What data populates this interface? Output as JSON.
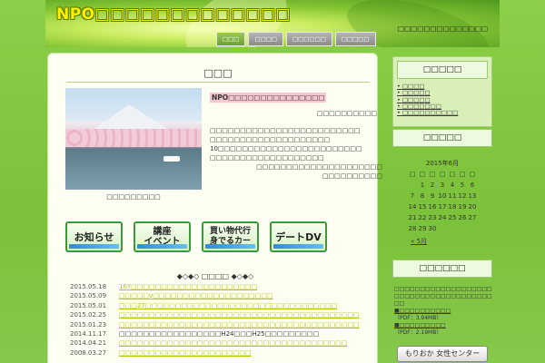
{
  "header": {
    "site_title": "NPO□□□□□□□□□□□□□",
    "tagline": "□□□□□□□□□□□□□□",
    "nav": [
      "□□□",
      "□□□□",
      "□□□□□□",
      "□□□□□"
    ]
  },
  "main": {
    "page_title": "□□□",
    "photo_caption": "□□□□□□□□□",
    "org_name": "NPO□□□□□□□□□□□□□□□",
    "subtitle": "□□□□□□□□□□",
    "description": [
      "□□□□□□□□□□□□□□□□□□□□□□□□□",
      "□□□□□□□□□□□□□□□□□□□□",
      "10□□□□□□□□□□□□□□□□□□□□□□□□",
      "□□□□□□□□□□□□□□□□□□□"
    ],
    "address": [
      "□□□□□□□□□□□□□□□□□□□□□",
      "□□□□□□□□□□"
    ],
    "buttons": [
      {
        "label": "お知らせ"
      },
      {
        "label": "講座\nイベント"
      },
      {
        "label": "買い物代行\n身でるカー"
      },
      {
        "label": "デートDV"
      }
    ],
    "news_title": "◆◇◆◇ □□□□ ◆◇◆◇",
    "news": [
      {
        "date": "2015.05.18",
        "text": "16Y□□□□□□□□□□□□□□□□□□□□□",
        "link": true
      },
      {
        "date": "2015.05.09",
        "text": "□□□□□v□□□□□□□□□□□□□□□□□□□□",
        "link": true
      },
      {
        "date": "2015.05.01",
        "text": "□□□27□□□□□□□□□□□□□□□□□□□□□□□□□□□□□□□□",
        "link": true
      },
      {
        "date": "2015.02.25",
        "text": "□□□□□□□□□□□□□□□□□□□□□□□□□□□□□□□□□□□□□□□□",
        "link": true
      },
      {
        "date": "2015.01.23",
        "text": "□□□□□□□□□□□□□□□□□□□□□□□□□□□□□□□□□□□□□□□□",
        "link": true
      },
      {
        "date": "2014.11.17",
        "text": "□□□□□□□□□□□□□□□□□H24□□□H25□□□□□□□□□",
        "link": false
      },
      {
        "date": "2014.04.21",
        "text": "□□□□□□□□□□□□□□□□□□□□□□□□□□□□□□□□□□□□□□",
        "link": true
      },
      {
        "date": "2008.03.27",
        "text": "□□□□□□□□□□□□□□□□□□□□□□",
        "link": true
      }
    ]
  },
  "sidebar": {
    "widget1": {
      "title": "□□□□□",
      "items": [
        "□□□□",
        "□□□□□",
        "□□□□□",
        "□□□□□□□",
        "□□□□□□□□□□"
      ]
    },
    "calendar": {
      "title": "□□□□□",
      "caption": "2015年6月",
      "weekdays": [
        "□",
        "□",
        "□",
        "□",
        "□",
        "□",
        "□"
      ],
      "days": [
        "",
        "1",
        "2",
        "3",
        "4",
        "5",
        "6",
        "7",
        "8",
        "9",
        "10",
        "11",
        "12",
        "13",
        "14",
        "15",
        "16",
        "17",
        "18",
        "19",
        "20",
        "21",
        "22",
        "23",
        "24",
        "25",
        "26",
        "27",
        "28",
        "29",
        "30",
        "",
        "",
        "",
        ""
      ],
      "prev": "« 5月"
    },
    "widget3": {
      "title": "□□□□□□",
      "text": "□□□□□□□□□□□□□□□□□□□□□□□□□□□□□□□□□□□□□□□□",
      "link1": "■□□□□□□□□□□",
      "size1": "（PDF：3.94MB）",
      "link2": "■□□□□□□□□□",
      "size2": "（PDF：2.19MB）"
    },
    "banner": "もりおか 女性センター"
  }
}
